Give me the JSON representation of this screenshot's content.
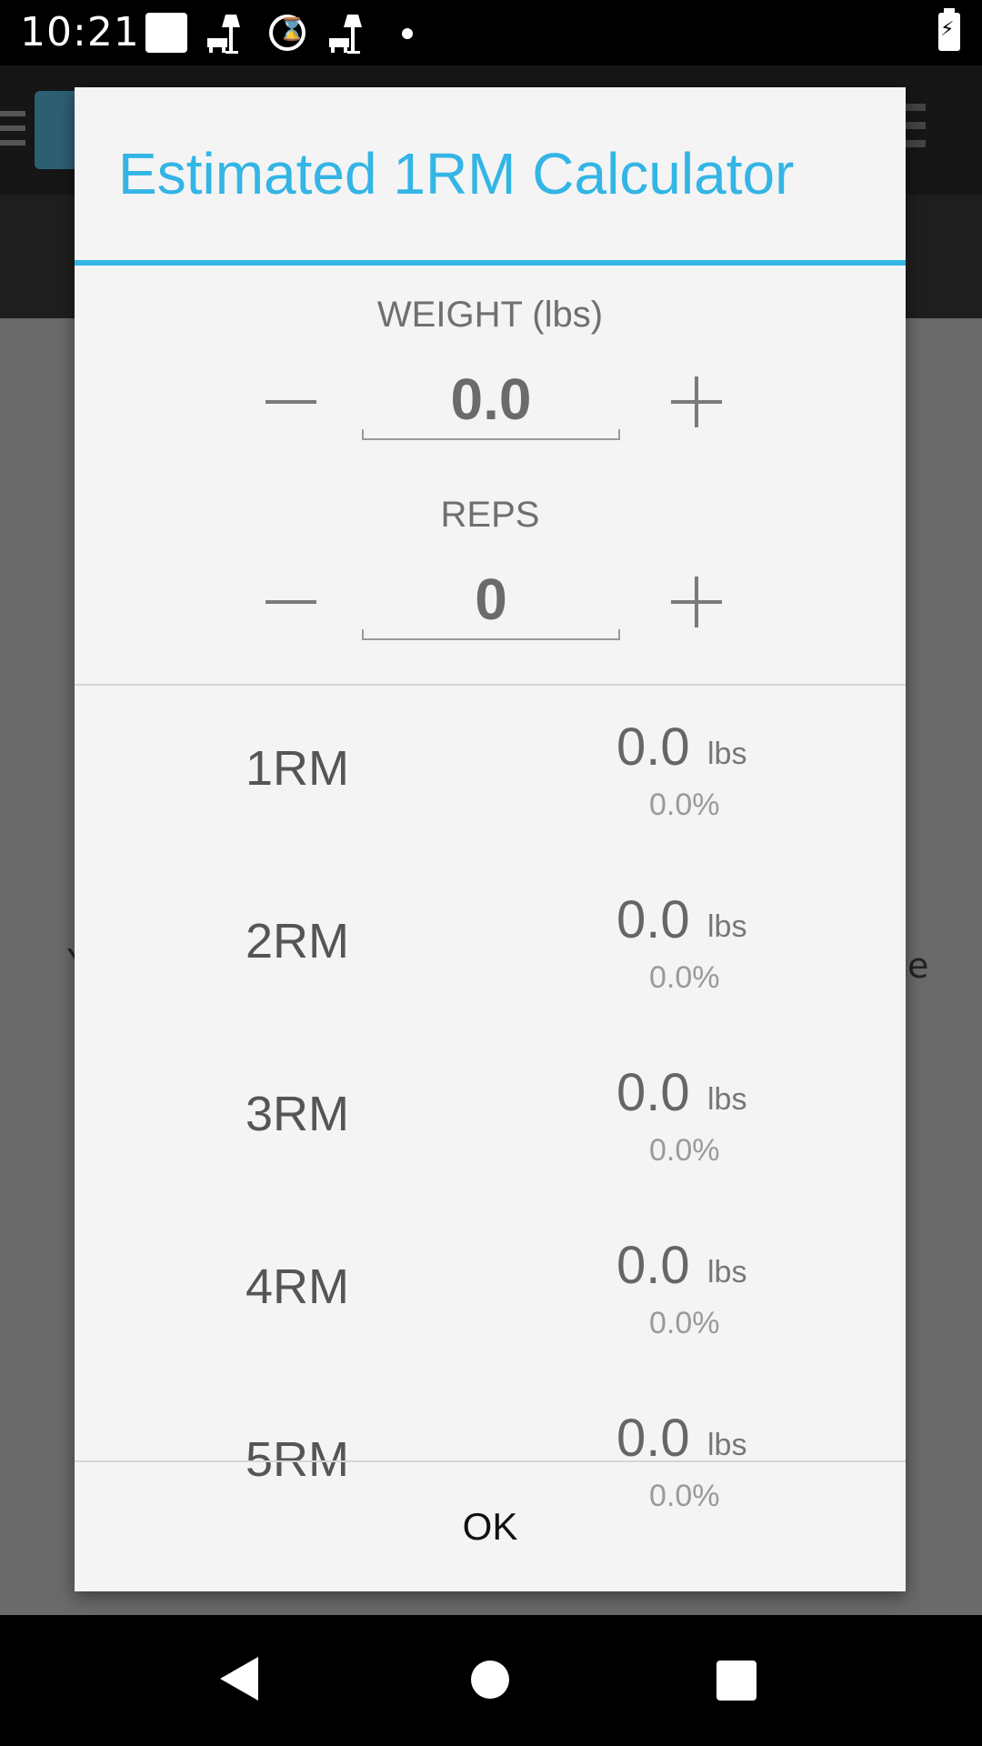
{
  "status_bar": {
    "time": "10:21",
    "icons": [
      "square-notification-icon",
      "lamp-icon",
      "timer-icon",
      "lamp-icon",
      "dot-icon",
      "battery-charging-icon"
    ]
  },
  "dialog": {
    "title": "Estimated 1RM Calculator",
    "weight": {
      "label": "WEIGHT (lbs)",
      "value": "0.0"
    },
    "reps": {
      "label": "REPS",
      "value": "0"
    },
    "results": [
      {
        "label": "1RM",
        "value": "0.0",
        "unit": "lbs",
        "percent": "0.0%"
      },
      {
        "label": "2RM",
        "value": "0.0",
        "unit": "lbs",
        "percent": "0.0%"
      },
      {
        "label": "3RM",
        "value": "0.0",
        "unit": "lbs",
        "percent": "0.0%"
      },
      {
        "label": "4RM",
        "value": "0.0",
        "unit": "lbs",
        "percent": "0.0%"
      },
      {
        "label": "5RM",
        "value": "0.0",
        "unit": "lbs",
        "percent": "0.0%"
      }
    ],
    "ok_label": "OK"
  },
  "background": {
    "left_text": "Y",
    "right_text": "e"
  },
  "colors": {
    "accent": "#33b5e5",
    "dialog_bg": "#f4f4f4",
    "scrim": "#6a6a6a"
  }
}
